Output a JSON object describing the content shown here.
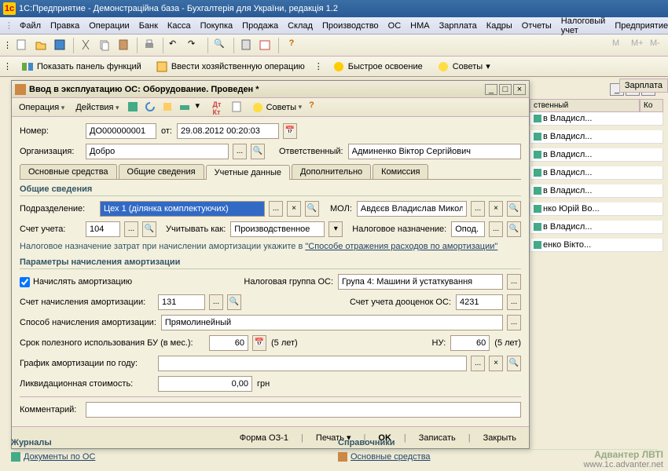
{
  "app": {
    "title": "1С:Предприятие - Демонстраційна база - Бухгалтерія для України, редакція 1.2"
  },
  "menu": [
    "Файл",
    "Правка",
    "Операции",
    "Банк",
    "Касса",
    "Покупка",
    "Продажа",
    "Склад",
    "Производство",
    "ОС",
    "НМА",
    "Зарплата",
    "Кадры",
    "Отчеты",
    "Налоговый учет",
    "Предприятие"
  ],
  "toolbar2": {
    "show_panel": "Показать панель функций",
    "enter_op": "Ввести хозяйственную операцию",
    "quick": "Быстрое освоение",
    "advice": "Советы"
  },
  "side_tab": "Зарплата",
  "bg_list": {
    "headers": [
      "ственный",
      "Ко"
    ],
    "rows": [
      "в Владисл...",
      "в Владисл...",
      "в Владисл...",
      "в Владисл...",
      "в Владисл...",
      "нко Юрій Во...",
      "в Владисл...",
      "енко Вікто..."
    ]
  },
  "dialog": {
    "title": "Ввод в эксплуатацию ОС: Оборудование. Проведен *",
    "tb": {
      "operation": "Операция",
      "actions": "Действия",
      "advice": "Советы"
    },
    "number_lbl": "Номер:",
    "number": "ДО000000001",
    "from_lbl": "от:",
    "date": "29.08.2012 00:20:03",
    "org_lbl": "Организация:",
    "org": "Добро",
    "resp_lbl": "Ответственный:",
    "resp": "Админенко Віктор Сергійович",
    "tabs": [
      "Основные средства",
      "Общие сведения",
      "Учетные данные",
      "Дополнительно",
      "Комиссия"
    ],
    "section1": "Общие сведения",
    "division_lbl": "Подразделение:",
    "division": "Цех 1 (ділянка комплектуючих)",
    "mol_lbl": "МОЛ:",
    "mol": "Авдєєв Владислав Миколайови",
    "account_lbl": "Счет учета:",
    "account": "104",
    "consider_lbl": "Учитывать как:",
    "consider": "Производственное",
    "tax_purpose_lbl": "Налоговое назначение:",
    "tax_purpose": "Опод. ПДВ",
    "note_pre": "Налоговое назначение затрат при начислении амортизации укажите в ",
    "note_link": "\"Способе отражения расходов по амортизации\"",
    "section2": "Параметры начисления амортизации",
    "calc_amort": "Начислять амортизацию",
    "tax_group_lbl": "Налоговая группа ОС:",
    "tax_group": "Група 4: Машини й устаткування",
    "amort_acc_lbl": "Счет начисления амортизации:",
    "amort_acc": "131",
    "reval_acc_lbl": "Счет учета дооценок ОС:",
    "reval_acc": "4231",
    "method_lbl": "Способ начисления амортизации:",
    "method": "Прямолинейный",
    "life_lbl": "Срок полезного использования БУ (в мес.):",
    "life_bu": "60",
    "life_bu_txt": "(5 лет)",
    "nu_lbl": "НУ:",
    "life_nu": "60",
    "life_nu_txt": "(5 лет)",
    "schedule_lbl": "График амортизации по году:",
    "liq_lbl": "Ликвидационная стоимость:",
    "liq": "0,00",
    "liq_cur": "грн",
    "comment_lbl": "Комментарий:",
    "footer": {
      "form": "Форма ОЗ-1",
      "print": "Печать",
      "ok": "OK",
      "save": "Записать",
      "close": "Закрыть"
    }
  },
  "bottom": {
    "journals": "Журналы",
    "docs_os": "Документы по ОС",
    "refs": "Справочники",
    "os": "Основные средства"
  },
  "brand": {
    "name": "Адвантер ЛВТІ",
    "url": "www.1c.advanter.net"
  }
}
